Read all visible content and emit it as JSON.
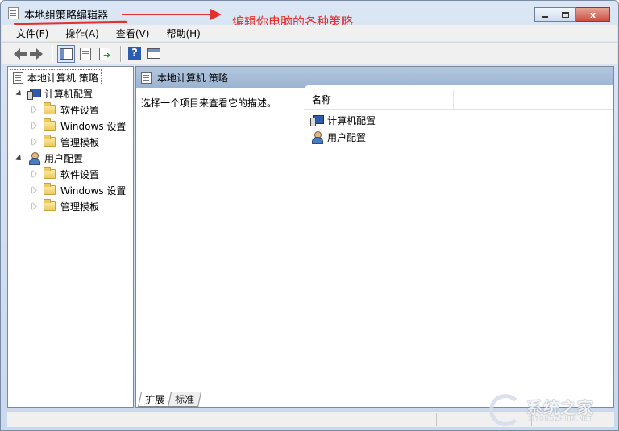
{
  "window": {
    "title": "本地组策略编辑器",
    "annotation": "编辑你电脑的各种策略",
    "annotation_color": "#e3322e",
    "controls": {
      "minimize_icon": "minimize-icon",
      "maximize_icon": "maximize-icon",
      "close_icon": "close-icon",
      "close_glyph": "x"
    }
  },
  "menu": {
    "items": [
      "文件(F)",
      "操作(A)",
      "查看(V)",
      "帮助(H)"
    ]
  },
  "toolbar": {
    "icons": [
      "back-arrow-icon",
      "forward-arrow-icon",
      "show-hide-tree-icon",
      "properties-icon",
      "export-list-icon",
      "help-icon",
      "view-icon"
    ],
    "help_glyph": "?"
  },
  "tree": {
    "root": "本地计算机 策略",
    "computer": {
      "label": "计算机配置",
      "children": [
        "软件设置",
        "Windows 设置",
        "管理模板"
      ]
    },
    "user": {
      "label": "用户配置",
      "children": [
        "软件设置",
        "Windows 设置",
        "管理模板"
      ]
    }
  },
  "details": {
    "header": "本地计算机 策略",
    "description": "选择一个项目来查看它的描述。",
    "column_name": "名称",
    "items": [
      "计算机配置",
      "用户配置"
    ],
    "tabs": [
      "扩展",
      "标准"
    ]
  },
  "watermark": {
    "text": "系统之家",
    "subtext": "XITONGZHIJIA.NET"
  },
  "colors": {
    "accent": "#e3322e",
    "header_bg": "#9bb4d2",
    "chrome": "#f0f0f0"
  }
}
